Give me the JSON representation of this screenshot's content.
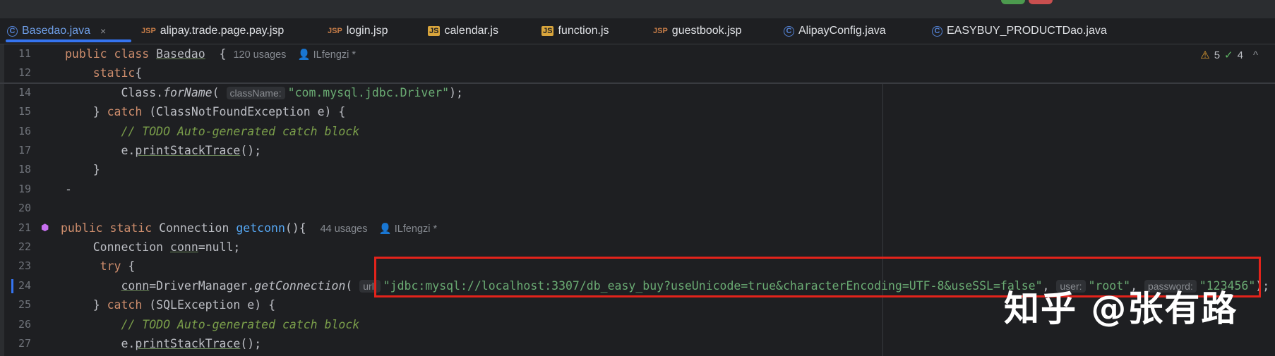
{
  "tabs": [
    {
      "label": "Basedao.java",
      "icon": "java-class-icon",
      "active": true
    },
    {
      "label": "alipay.trade.page.pay.jsp",
      "icon": "jsp-icon"
    },
    {
      "label": "login.jsp",
      "icon": "jsp-icon"
    },
    {
      "label": "calendar.js",
      "icon": "js-icon"
    },
    {
      "label": "function.js",
      "icon": "js-icon"
    },
    {
      "label": "guestbook.jsp",
      "icon": "jsp-icon"
    },
    {
      "label": "AlipayConfig.java",
      "icon": "java-class-icon"
    },
    {
      "label": "EASYBUY_PRODUCTDao.java",
      "icon": "java-class-icon"
    }
  ],
  "tab_icon_text": {
    "java": "C",
    "jsp": "JSP",
    "js": "JS"
  },
  "close_glyph": "×",
  "inspections": {
    "warnings": "5",
    "weak_warnings": "4",
    "warning_icon": "⚠",
    "check_icon": "✓",
    "expand_icon": "^"
  },
  "lines": [
    {
      "n": "11",
      "tokens": [
        [
          "kw",
          "public class "
        ],
        [
          "ul",
          "Basedao"
        ],
        [
          "",
          "  { "
        ],
        [
          "meta",
          "120 usages    👤 ILfengzi *"
        ]
      ]
    },
    {
      "n": "12",
      "tokens": [
        [
          "kw",
          "    static"
        ],
        [
          "",
          "{"
        ]
      ]
    },
    {
      "n": "14",
      "tokens": [
        [
          "",
          "        Class."
        ],
        [
          "it",
          "forName"
        ],
        [
          "",
          "( "
        ],
        [
          "hint",
          "className:"
        ],
        [
          "str",
          "\"com.mysql.jdbc.Driver\""
        ],
        [
          "",
          ");"
        ]
      ]
    },
    {
      "n": "15",
      "tokens": [
        [
          "",
          "    } "
        ],
        [
          "kw",
          "catch"
        ],
        [
          "",
          " (ClassNotFoundException e) {"
        ]
      ]
    },
    {
      "n": "16",
      "tokens": [
        [
          "cmt",
          "        // TODO Auto-generated catch block"
        ]
      ]
    },
    {
      "n": "17",
      "tokens": [
        [
          "",
          "        e."
        ],
        [
          "ul",
          "printStackTrace"
        ],
        [
          "",
          "();"
        ]
      ]
    },
    {
      "n": "18",
      "tokens": [
        [
          "",
          "    }"
        ]
      ]
    },
    {
      "n": "19",
      "tokens": [
        [
          "",
          "-"
        ]
      ]
    },
    {
      "n": "20",
      "tokens": []
    },
    {
      "n": "21",
      "tokens": [
        [
          "kw",
          "public static "
        ],
        [
          "",
          "Connection "
        ],
        [
          "fn",
          "getconn"
        ],
        [
          "",
          "(){  "
        ],
        [
          "meta",
          "44 usages    👤 ILfengzi *"
        ]
      ]
    },
    {
      "n": "22",
      "tokens": [
        [
          "",
          "    Connection "
        ],
        [
          "ul",
          "conn"
        ],
        [
          "",
          "=null;"
        ]
      ]
    },
    {
      "n": "23",
      "tokens": [
        [
          "kw",
          "     try"
        ],
        [
          "",
          " {"
        ]
      ]
    },
    {
      "n": "24",
      "tokens": [
        [
          "",
          "        "
        ],
        [
          "ul",
          "conn"
        ],
        [
          "",
          "=DriverManager."
        ],
        [
          "it",
          "getConnection"
        ],
        [
          "",
          "( "
        ],
        [
          "hint",
          "url:"
        ],
        [
          "str",
          "\"jdbc:mysql://localhost:3307/db_easy_buy?useUnicode=true&characterEncoding=UTF-8&useSSL=false\""
        ],
        [
          "",
          ", "
        ],
        [
          "hint",
          "user:"
        ],
        [
          "str",
          "\"root\""
        ],
        [
          "",
          ", "
        ],
        [
          "hint",
          "password:"
        ],
        [
          "str",
          "\"123456\""
        ],
        [
          "",
          ");"
        ]
      ]
    },
    {
      "n": "25",
      "tokens": [
        [
          "",
          "    } "
        ],
        [
          "kw",
          "catch"
        ],
        [
          "",
          " (SQLException e) {"
        ]
      ]
    },
    {
      "n": "26",
      "tokens": [
        [
          "cmt",
          "        // TODO Auto-generated catch block"
        ]
      ]
    },
    {
      "n": "27",
      "tokens": [
        [
          "",
          "        e."
        ],
        [
          "ul",
          "printStackTrace"
        ],
        [
          "",
          "();"
        ]
      ]
    }
  ],
  "watermark": "知乎 @张有路"
}
